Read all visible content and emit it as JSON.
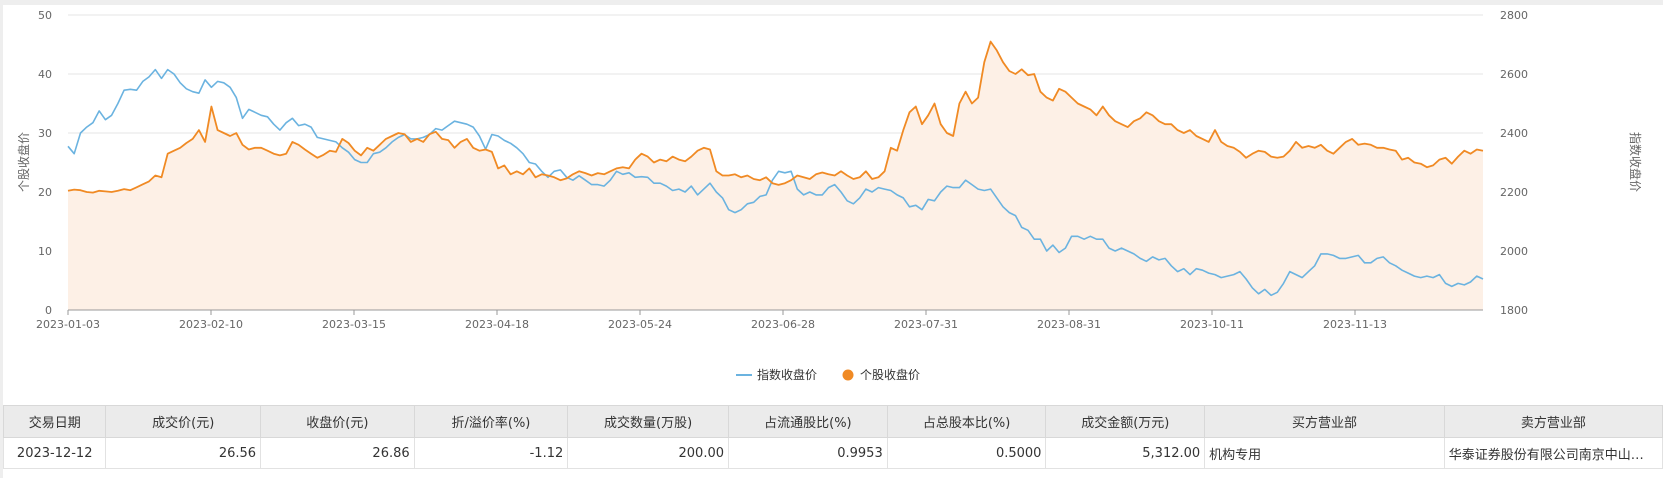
{
  "chart_data": {
    "type": "line",
    "x_ticks": [
      "2023-01-03",
      "2023-02-10",
      "2023-03-15",
      "2023-04-18",
      "2023-05-24",
      "2023-06-28",
      "2023-07-31",
      "2023-08-31",
      "2023-10-11",
      "2023-11-13"
    ],
    "y_left": {
      "label": "个股收盘价",
      "ticks": [
        0,
        10,
        20,
        30,
        40,
        50
      ],
      "ylim": [
        0,
        50
      ]
    },
    "y_right": {
      "label": "指数收盘价",
      "ticks": [
        1800,
        2000,
        2200,
        2400,
        2600,
        2800
      ],
      "ylim": [
        1800,
        2800
      ]
    },
    "legend_position": "bottom-center",
    "grid": true,
    "series": [
      {
        "name": "指数收盘价",
        "axis": "right",
        "color": "#6bb3e0",
        "values": [
          2355,
          2330,
          2400,
          2420,
          2435,
          2475,
          2445,
          2460,
          2500,
          2545,
          2548,
          2545,
          2575,
          2590,
          2615,
          2585,
          2615,
          2600,
          2570,
          2550,
          2540,
          2535,
          2580,
          2555,
          2575,
          2570,
          2555,
          2520,
          2450,
          2480,
          2470,
          2460,
          2455,
          2430,
          2410,
          2435,
          2450,
          2425,
          2430,
          2420,
          2385,
          2380,
          2375,
          2370,
          2350,
          2335,
          2310,
          2300,
          2300,
          2330,
          2335,
          2350,
          2370,
          2385,
          2395,
          2380,
          2380,
          2385,
          2395,
          2415,
          2410,
          2425,
          2440,
          2435,
          2430,
          2420,
          2390,
          2345,
          2395,
          2390,
          2375,
          2365,
          2350,
          2330,
          2300,
          2295,
          2270,
          2250,
          2270,
          2275,
          2250,
          2240,
          2255,
          2240,
          2225,
          2225,
          2220,
          2240,
          2270,
          2260,
          2265,
          2250,
          2252,
          2250,
          2230,
          2230,
          2220,
          2205,
          2210,
          2200,
          2220,
          2190,
          2210,
          2230,
          2200,
          2180,
          2140,
          2130,
          2140,
          2160,
          2165,
          2185,
          2190,
          2240,
          2270,
          2265,
          2270,
          2210,
          2190,
          2200,
          2190,
          2190,
          2215,
          2225,
          2200,
          2170,
          2160,
          2180,
          2210,
          2200,
          2215,
          2210,
          2205,
          2190,
          2180,
          2150,
          2155,
          2140,
          2175,
          2170,
          2200,
          2220,
          2215,
          2215,
          2240,
          2225,
          2210,
          2205,
          2210,
          2180,
          2150,
          2130,
          2120,
          2080,
          2070,
          2040,
          2040,
          2000,
          2020,
          1995,
          2010,
          2050,
          2050,
          2040,
          2050,
          2040,
          2040,
          2010,
          2000,
          2010,
          2000,
          1990,
          1975,
          1965,
          1980,
          1970,
          1975,
          1950,
          1930,
          1940,
          1920,
          1940,
          1935,
          1925,
          1920,
          1910,
          1915,
          1920,
          1930,
          1905,
          1875,
          1855,
          1870,
          1850,
          1860,
          1890,
          1930,
          1920,
          1910,
          1930,
          1950,
          1990,
          1990,
          1985,
          1975,
          1975,
          1980,
          1985,
          1960,
          1960,
          1975,
          1980,
          1960,
          1950,
          1935,
          1925,
          1915,
          1910,
          1915,
          1910,
          1920,
          1890,
          1880,
          1890,
          1885,
          1895,
          1915,
          1905
        ]
      },
      {
        "name": "个股收盘价",
        "axis": "left",
        "color": "#f08a24",
        "fill": "#fdf0e6",
        "values": [
          20.2,
          20.4,
          20.3,
          20.0,
          19.9,
          20.2,
          20.1,
          20.0,
          20.2,
          20.5,
          20.3,
          20.8,
          21.3,
          21.8,
          22.8,
          22.5,
          26.5,
          27.0,
          27.5,
          28.3,
          29.0,
          30.5,
          28.5,
          34.5,
          30.5,
          30.0,
          29.5,
          30.0,
          28.0,
          27.2,
          27.5,
          27.5,
          27.0,
          26.5,
          26.2,
          26.5,
          28.5,
          28.0,
          27.2,
          26.5,
          25.8,
          26.3,
          27.0,
          26.8,
          29.0,
          28.3,
          27.0,
          26.2,
          27.5,
          27.0,
          28.0,
          29.0,
          29.5,
          30.0,
          29.8,
          28.5,
          29.0,
          28.5,
          29.8,
          30.2,
          29.0,
          28.8,
          27.5,
          28.5,
          29.0,
          27.5,
          27.0,
          27.2,
          26.8,
          24.0,
          24.5,
          23.0,
          23.5,
          23.0,
          24.0,
          22.5,
          23.0,
          22.8,
          22.5,
          22.0,
          22.3,
          23.0,
          23.5,
          23.2,
          22.8,
          23.2,
          23.0,
          23.5,
          24.0,
          24.2,
          24.0,
          25.5,
          26.5,
          26.0,
          25.0,
          25.5,
          25.2,
          26.0,
          25.5,
          25.2,
          26.0,
          27.0,
          27.5,
          27.2,
          23.5,
          22.8,
          22.8,
          23.0,
          22.5,
          22.8,
          22.2,
          22.0,
          22.5,
          21.5,
          21.2,
          21.5,
          22.0,
          22.8,
          22.5,
          22.2,
          23.0,
          23.3,
          23.0,
          22.8,
          23.5,
          22.8,
          22.2,
          22.5,
          23.5,
          22.2,
          22.5,
          23.5,
          27.5,
          27.0,
          30.5,
          33.5,
          34.5,
          31.5,
          33.0,
          35.0,
          31.5,
          30.0,
          29.5,
          35.0,
          37.0,
          35.0,
          36.0,
          42.0,
          45.5,
          44.0,
          42.0,
          40.5,
          40.0,
          40.8,
          39.8,
          40.0,
          37.0,
          36.0,
          35.5,
          37.5,
          37.0,
          36.0,
          35.0,
          34.5,
          34.0,
          33.0,
          34.5,
          33.0,
          32.0,
          31.5,
          31.0,
          32.0,
          32.5,
          33.5,
          33.0,
          32.0,
          31.5,
          31.5,
          30.5,
          30.0,
          30.5,
          29.5,
          29.0,
          28.5,
          30.5,
          28.5,
          27.8,
          27.5,
          26.8,
          25.8,
          26.5,
          27.0,
          26.8,
          26.0,
          25.8,
          26.0,
          27.0,
          28.5,
          27.5,
          27.8,
          27.5,
          28.0,
          27.0,
          26.5,
          27.5,
          28.5,
          29.0,
          28.0,
          28.2,
          28.0,
          27.5,
          27.5,
          27.2,
          27.0,
          25.5,
          25.8,
          25.0,
          24.8,
          24.2,
          24.5,
          25.5,
          25.8,
          24.8,
          26.0,
          27.0,
          26.5,
          27.2,
          27.0
        ]
      }
    ]
  },
  "table": {
    "headers": [
      "交易日期",
      "成交价(元)",
      "收盘价(元)",
      "折/溢价率(%)",
      "成交数量(万股)",
      "占流通股比(%)",
      "占总股本比(%)",
      "成交金额(万元)",
      "买方营业部",
      "卖方营业部"
    ],
    "rows": [
      [
        "2023-12-12",
        "26.56",
        "26.86",
        "-1.12",
        "200.00",
        "0.9953",
        "0.5000",
        "5,312.00",
        "机构专用",
        "华泰证券股份有限公司南京中山…"
      ]
    ]
  }
}
